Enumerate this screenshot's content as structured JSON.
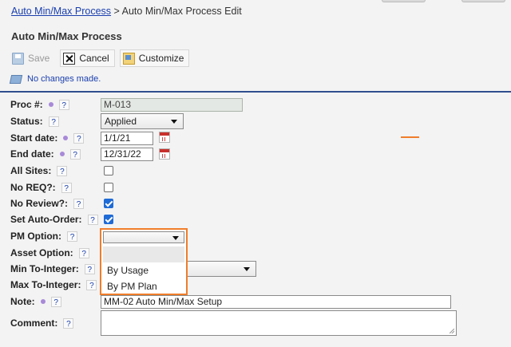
{
  "breadcrumb": {
    "link": "Auto Min/Max Process",
    "separator": ">",
    "current": "Auto Min/Max Process Edit"
  },
  "page_title": "Auto Min/Max Process",
  "toolbar": {
    "save_label": "Save",
    "cancel_label": "Cancel",
    "customize_label": "Customize"
  },
  "status_message": "No changes made.",
  "form": {
    "help_glyph": "?",
    "proc_label": "Proc #:",
    "proc_value": "M-013",
    "status_label": "Status:",
    "status_value": "Applied",
    "start_label": "Start date:",
    "start_value": "1/1/21",
    "end_label": "End date:",
    "end_value": "12/31/22",
    "all_sites_label": "All Sites:",
    "no_req_label": "No REQ?:",
    "no_review_label": "No Review?:",
    "set_auto_order_label": "Set Auto-Order:",
    "pm_option_label": "PM Option:",
    "asset_option_label": "Asset Option:",
    "min_to_integer_label": "Min To-Integer:",
    "max_to_integer_label": "Max To-Integer:",
    "note_label": "Note:",
    "note_value": "MM-02 Auto Min/Max Setup",
    "comment_label": "Comment:"
  },
  "pm_option_dropdown": {
    "options": [
      "",
      "By Usage",
      "By PM Plan"
    ]
  },
  "colors": {
    "highlight": "#f07d2a",
    "link": "#1a3fae",
    "divider": "#2f4f8f",
    "checkbox_checked": "#1e6ad6"
  }
}
